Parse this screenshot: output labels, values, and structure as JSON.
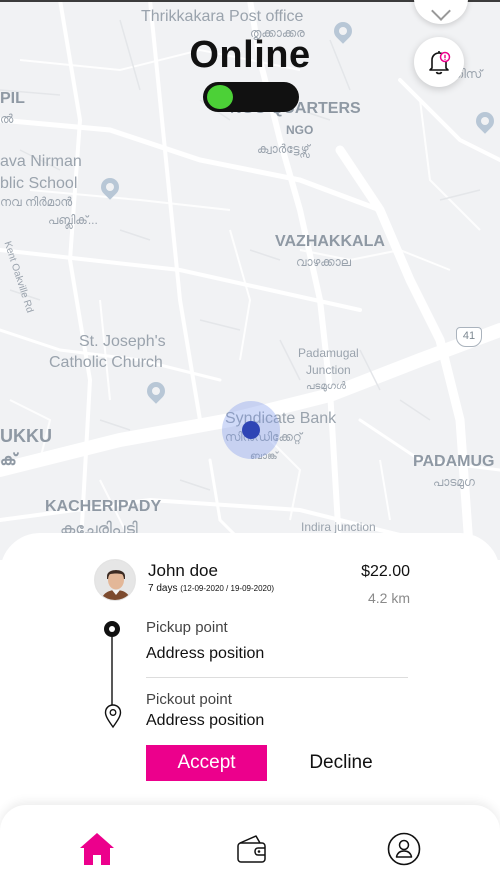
{
  "map": {
    "labels": {
      "thrikkakara": "Thrikkakara Post office",
      "thrikkakara_ml": "തൃക്കാക്കര",
      "ngo_quarters": "NGO QUARTERS",
      "ngo": "NGO",
      "ngo_ml": "ക്വാർട്ടേഴ്സ്",
      "pil": "PIL",
      "pil_ml": "ൽ",
      "school_1": "ava Nirman",
      "school_2": "blic School",
      "school_ml_1": "നവ നിർമാൻ",
      "school_ml_2": "പബ്ലിക്...",
      "kent_rd": "Kent Oakville Rd",
      "vazhakkala": "VAZHAKKALA",
      "vazhakkala_ml": "വാഴക്കാല",
      "church_1": "St. Joseph's",
      "church_2": "Catholic Church",
      "padamugal_1": "Padamugal",
      "padamugal_2": "Junction",
      "padamugal_ml": "പടമുഗൾ",
      "ukku": "UKKU",
      "ukku_ml": "ക്",
      "syndicate": "Syndicate Bank",
      "syndicate_ml_1": "സിൻഡിക്കേറ്റ്",
      "syndicate_ml_2": "ബാങ്ക്",
      "padamugal_right": "PADAMUG",
      "padamugal_right_ml": "പാടമുഗ",
      "kacheripady": "KACHERIPADY",
      "kacheripady_ml": "കച്ചേരിപ്പടി",
      "indira": "Indira junction",
      "right_top_ml": "ന്തിസ്",
      "highway_number": "41"
    }
  },
  "header": {
    "status": "Online",
    "toggle_on": true,
    "toggle_color": "#4cd137"
  },
  "icons": {
    "bell": "bell-icon",
    "home": "home-icon",
    "wallet": "wallet-icon",
    "profile": "user-icon"
  },
  "ride": {
    "rider_name": "John doe",
    "days": "7 days",
    "dates": "(12-09-2020 / 19-09-2020)",
    "fare": "$22.00",
    "distance": "4.2 km",
    "pickup_label": "Pickup point",
    "pickup_address": "Address position",
    "dropoff_label": "Pickout point",
    "dropoff_address": "Address position"
  },
  "actions": {
    "accept": "Accept",
    "decline": "Decline"
  },
  "colors": {
    "accent": "#ec008c",
    "location_dot": "#2f45b5"
  }
}
